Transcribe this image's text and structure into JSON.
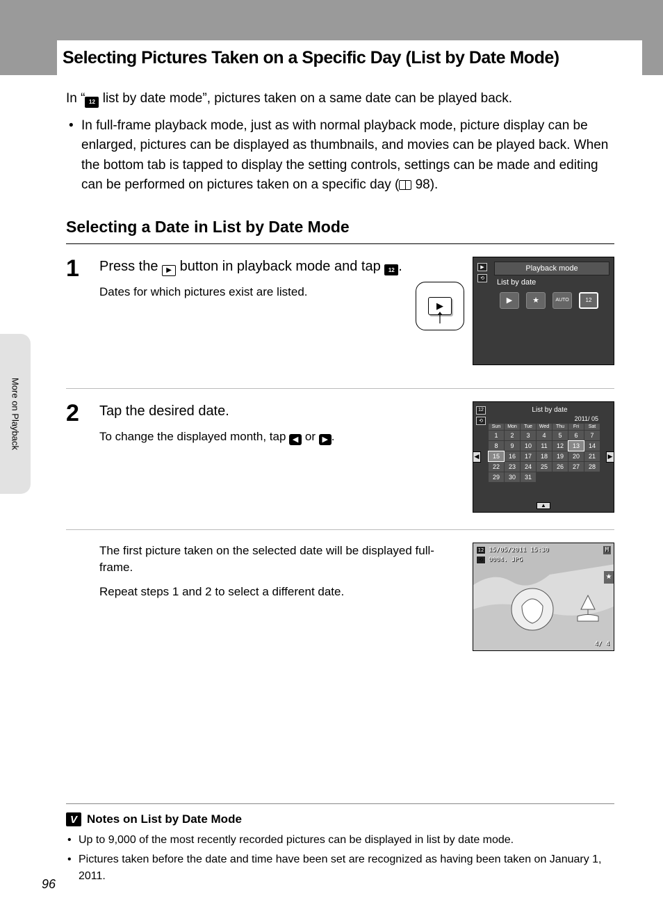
{
  "page_number": "96",
  "side_tab": "More on Playback",
  "title": "Selecting Pictures Taken on a Specific Day (List by Date Mode)",
  "intro": {
    "prefix": "In “",
    "suffix": " list by date mode”, pictures taken on a same date can be played back."
  },
  "bullet1_a": "In full-frame playback mode, just as with normal playback mode, picture display can be enlarged, pictures can be displayed as thumbnails, and movies can be played back. When the bottom tab is tapped to display the setting controls, settings can be made and editing can be performed on pictures taken on a specific day (",
  "bullet1_b": " 98).",
  "subhead": "Selecting a Date in List by Date Mode",
  "step1": {
    "num": "1",
    "line_a": "Press the ",
    "line_b": " button in playback mode and tap ",
    "line_c": ".",
    "sub": "Dates for which pictures exist are listed."
  },
  "screen1": {
    "title": "Playback mode",
    "sub": "List by date",
    "icons": [
      "▶",
      "★",
      "AUTO",
      "12"
    ]
  },
  "step2": {
    "num": "2",
    "line": "Tap the desired date.",
    "sub_a": "To change the displayed month, tap ",
    "sub_b": " or ",
    "sub_c": "."
  },
  "calendar": {
    "title": "List by date",
    "ym": "2011/ 05",
    "days": [
      "Sun",
      "Mon",
      "Tue",
      "Wed",
      "Thu",
      "Fri",
      "Sat"
    ],
    "cells": [
      "1",
      "2",
      "3",
      "4",
      "5",
      "6",
      "7",
      "8",
      "9",
      "10",
      "11",
      "12",
      "13",
      "14",
      "15",
      "16",
      "17",
      "18",
      "19",
      "20",
      "21",
      "22",
      "23",
      "24",
      "25",
      "26",
      "27",
      "28",
      "29",
      "30",
      "31"
    ],
    "highlight": [
      "13",
      "15"
    ]
  },
  "step2b": {
    "sub1": "The first picture taken on the selected date will be displayed full-frame.",
    "sub2": "Repeat steps 1 and 2 to select a different date."
  },
  "photo": {
    "datetime": "15/05/2011 15:30",
    "file": "0004. JPG",
    "counter": "4/     4"
  },
  "notes": {
    "head": "Notes on List by Date Mode",
    "b1": "Up to 9,000 of the most recently recorded pictures can be displayed in list by date mode.",
    "b2": "Pictures taken before the date and time have been set are recognized as having been taken on January 1, 2011."
  }
}
